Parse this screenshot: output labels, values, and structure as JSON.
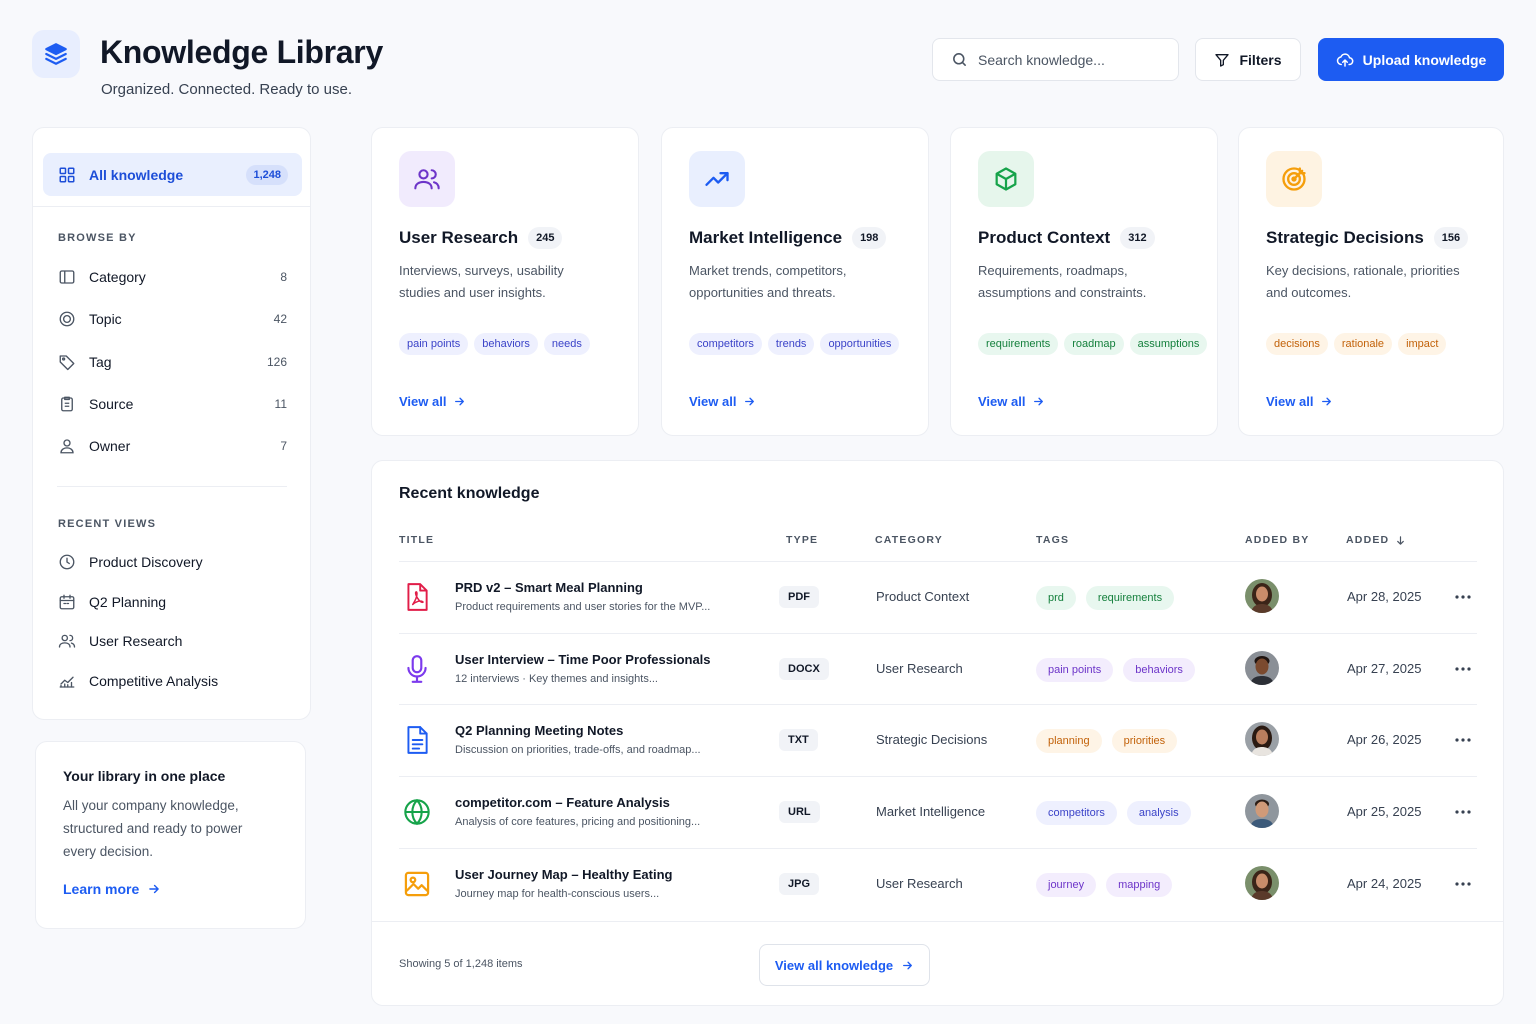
{
  "header": {
    "title": "Knowledge Library",
    "subtitle": "Organized. Connected. Ready to use.",
    "search_placeholder": "Search knowledge...",
    "filters_label": "Filters",
    "upload_label": "Upload knowledge"
  },
  "sidebar": {
    "all": {
      "label": "All knowledge",
      "count": "1,248"
    },
    "browse_heading": "BROWSE BY",
    "browse": [
      {
        "label": "Category",
        "count": "8",
        "icon": "category-icon"
      },
      {
        "label": "Topic",
        "count": "42",
        "icon": "topic-icon"
      },
      {
        "label": "Tag",
        "count": "126",
        "icon": "tag-icon"
      },
      {
        "label": "Source",
        "count": "11",
        "icon": "source-icon"
      },
      {
        "label": "Owner",
        "count": "7",
        "icon": "owner-icon"
      }
    ],
    "recent_heading": "RECENT VIEWS",
    "recent": [
      {
        "label": "Product Discovery",
        "icon": "clock-icon"
      },
      {
        "label": "Q2 Planning",
        "icon": "calendar-icon"
      },
      {
        "label": "User Research",
        "icon": "users-icon"
      },
      {
        "label": "Competitive Analysis",
        "icon": "chart-icon"
      }
    ]
  },
  "promo": {
    "title": "Your library in one place",
    "body": "All your company knowledge, structured and ready to power every decision.",
    "link": "Learn more"
  },
  "categories": [
    {
      "title": "User Research",
      "count": "245",
      "desc": "Interviews, surveys, usability studies and user insights.",
      "tags": [
        "pain points",
        "behaviors",
        "needs"
      ],
      "view": "View all",
      "icon": "users-icon",
      "accent": "#6d35c9"
    },
    {
      "title": "Market Intelligence",
      "count": "198",
      "desc": "Market trends, competitors, opportunities and threats.",
      "tags": [
        "competitors",
        "trends",
        "opportunities"
      ],
      "view": "View all",
      "icon": "trending-up-icon",
      "accent": "#1d5cf2"
    },
    {
      "title": "Product Context",
      "count": "312",
      "desc": "Requirements, roadmaps, assumptions and constraints.",
      "tags": [
        "requirements",
        "roadmap",
        "assumptions"
      ],
      "view": "View all",
      "icon": "cube-icon",
      "accent": "#16a34a"
    },
    {
      "title": "Strategic Decisions",
      "count": "156",
      "desc": "Key decisions, rationale, priorities and outcomes.",
      "tags": [
        "decisions",
        "rationale",
        "impact"
      ],
      "view": "View all",
      "icon": "target-icon",
      "accent": "#f59e0b"
    }
  ],
  "recent": {
    "title": "Recent knowledge",
    "columns": {
      "title": "TITLE",
      "type": "TYPE",
      "category": "CATEGORY",
      "tags": "TAGS",
      "added_by": "ADDED BY",
      "added": "ADDED"
    },
    "rows": [
      {
        "title": "PRD v2 – Smart Meal Planning",
        "subtitle": "Product requirements and user stories for the MVP...",
        "type": "PDF",
        "category": "Product Context",
        "tags": [
          "prd",
          "requirements"
        ],
        "date": "Apr 28, 2025",
        "icon": "pdf-file-icon"
      },
      {
        "title": "User Interview – Time Poor Professionals",
        "subtitle": "12 interviews · Key themes and insights...",
        "type": "DOCX",
        "category": "User Research",
        "tags": [
          "pain points",
          "behaviors"
        ],
        "date": "Apr 27, 2025",
        "icon": "microphone-icon"
      },
      {
        "title": "Q2 Planning Meeting Notes",
        "subtitle": "Discussion on priorities, trade-offs, and roadmap...",
        "type": "TXT",
        "category": "Strategic Decisions",
        "tags": [
          "planning",
          "priorities"
        ],
        "date": "Apr 26, 2025",
        "icon": "document-icon"
      },
      {
        "title": "competitor.com – Feature Analysis",
        "subtitle": "Analysis of core features, pricing and positioning...",
        "type": "URL",
        "category": "Market Intelligence",
        "tags": [
          "competitors",
          "analysis"
        ],
        "date": "Apr 25, 2025",
        "icon": "globe-icon"
      },
      {
        "title": "User Journey Map – Healthy Eating",
        "subtitle": "Journey map for health-conscious users...",
        "type": "JPG",
        "category": "User Research",
        "tags": [
          "journey",
          "mapping"
        ],
        "date": "Apr 24, 2025",
        "icon": "image-icon"
      }
    ],
    "showing": "Showing 5 of 1,248 items",
    "view_all": "View all knowledge"
  },
  "colors": {
    "accent": "#1d5cf2",
    "background": "#f8f9fc"
  }
}
